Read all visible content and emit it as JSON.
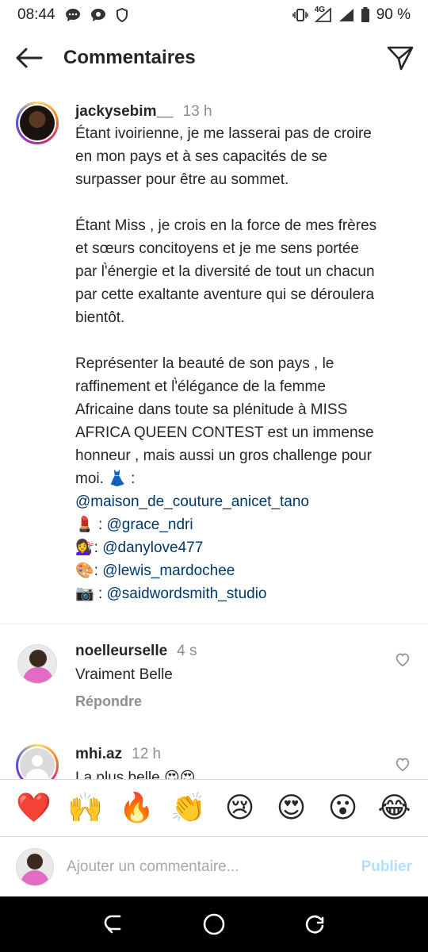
{
  "status_bar": {
    "time": "08:44",
    "network": "4G",
    "battery": "90 %"
  },
  "header": {
    "title": "Commentaires"
  },
  "caption": {
    "username": "jackysebim__",
    "time": "13 h",
    "paragraph1": "Étant ivoirienne, je me lasserai pas de croire en mon pays et à ses capacités de se surpasser pour être au sommet.",
    "paragraph2": "Étant Miss , je crois en la force de mes frères et sœurs concitoyens et je me sens portée par l'̀énergie et la diversité de tout un chacun par cette exaltante aventure qui se déroulera bientôt.",
    "paragraph3": "Représenter la beauté de son pays , le raffinement et l'̀élégance de la femme Africaine dans toute sa plénitude à MISS AFRICA QUEEN CONTEST est un immense honneur , mais aussi un gros challenge pour moi.",
    "credits": [
      {
        "emoji": "👗",
        "sep": " :",
        "handle": "@maison_de_couture_anicet_tano"
      },
      {
        "emoji": "💄",
        "sep": " : ",
        "handle": "@grace_ndri"
      },
      {
        "emoji": "💇‍♀️",
        "sep": ": ",
        "handle": "@danylove477"
      },
      {
        "emoji": "🎨",
        "sep": ": ",
        "handle": "@lewis_mardochee"
      },
      {
        "emoji": "📷",
        "sep": " : ",
        "handle": "@saidwordsmith_studio"
      }
    ]
  },
  "comments": [
    {
      "username": "noelleurselle",
      "time": "4 s",
      "text": "Vraiment Belle",
      "reply_label": "Répondre"
    },
    {
      "username": "mhi.az",
      "time": "12 h",
      "text": "La plus belle 😍😍"
    }
  ],
  "emoji_bar": [
    "❤️",
    "🙌",
    "🔥",
    "👏",
    "😢",
    "😍",
    "😮",
    "😂"
  ],
  "input": {
    "placeholder": "Ajouter un commentaire...",
    "publish_label": "Publier"
  }
}
